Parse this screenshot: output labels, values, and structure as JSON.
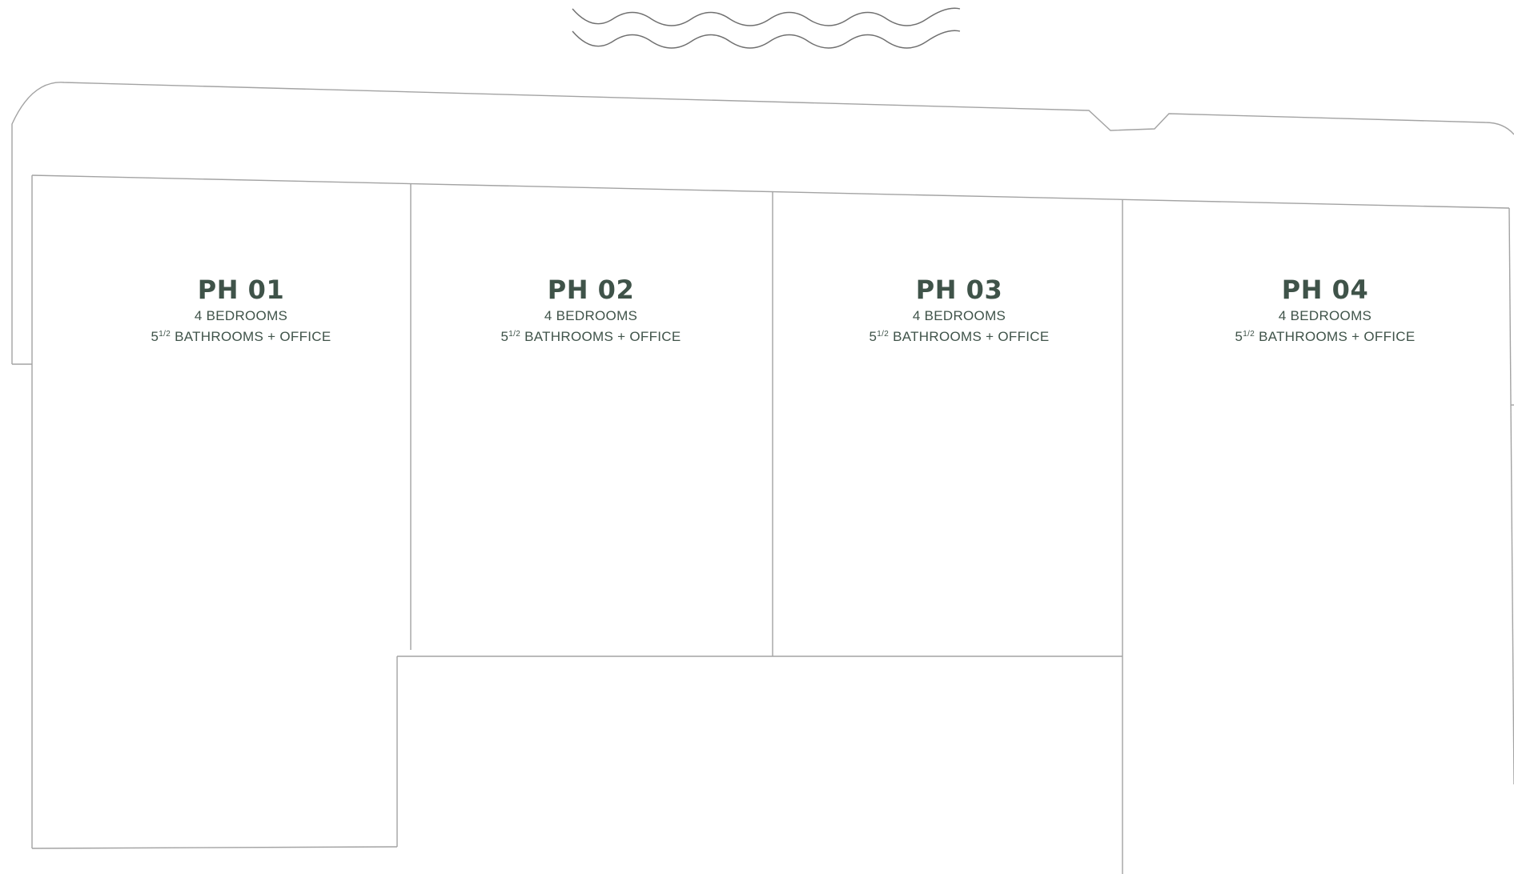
{
  "colors": {
    "label_text": "#3f5349",
    "outline": "#a3a3a3",
    "wave": "#6f6f6f",
    "background": "#ffffff"
  },
  "units": [
    {
      "name": "PH 01",
      "bedrooms": "4 BEDROOMS",
      "bath_number": "5",
      "bath_fraction": "1/2",
      "bath_rest": " BATHROOMS + OFFICE"
    },
    {
      "name": "PH 02",
      "bedrooms": "4 BEDROOMS",
      "bath_number": "5",
      "bath_fraction": "1/2",
      "bath_rest": " BATHROOMS + OFFICE"
    },
    {
      "name": "PH 03",
      "bedrooms": "4 BEDROOMS",
      "bath_number": "5",
      "bath_fraction": "1/2",
      "bath_rest": " BATHROOMS + OFFICE"
    },
    {
      "name": "PH 04",
      "bedrooms": "4 BEDROOMS",
      "bath_number": "5",
      "bath_fraction": "1/2",
      "bath_rest": " BATHROOMS + OFFICE"
    }
  ]
}
